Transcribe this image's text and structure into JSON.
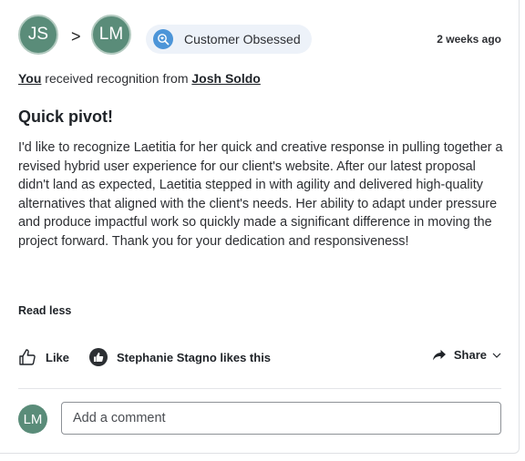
{
  "header": {
    "sender_initials": "JS",
    "arrow": ">",
    "recipient_initials": "LM",
    "badge_label": "Customer Obsessed",
    "badge_icon": "magnifier-heart-icon",
    "timestamp": "2 weeks ago"
  },
  "recognition": {
    "you": "You",
    "middle": " received recognition from ",
    "sender_name": "Josh Soldo"
  },
  "post": {
    "title": "Quick pivot!",
    "body": "I'd like to recognize Laetitia for her quick and creative response in pulling together a revised hybrid user experience for our client's website. After our latest proposal didn't land as expected, Laetitia stepped in with agility and delivered high-quality alternatives that aligned with the client's needs. Her ability to adapt under pressure and produce impactful work so quickly made a significant difference in moving the project forward. Thank you for your dedication and responsiveness!",
    "read_less": "Read less"
  },
  "actions": {
    "like_label": "Like",
    "likes_text": "Stephanie Stagno likes this",
    "share_label": "Share"
  },
  "comment": {
    "avatar_initials": "LM",
    "placeholder": "Add a comment"
  },
  "colors": {
    "avatar": "#5a8c79",
    "badge_bg": "#edf2f9",
    "badge_icon": "#4c95d8"
  }
}
